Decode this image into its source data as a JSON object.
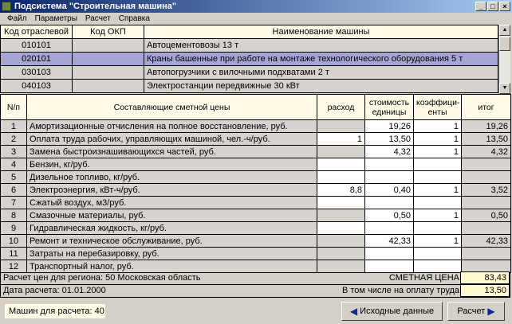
{
  "window": {
    "title": "Подсистема \"Строительная машина\""
  },
  "menu": [
    "Файл",
    "Параметры",
    "Расчет",
    "Справка"
  ],
  "machines": {
    "columns": [
      "Код отраслевой",
      "Код ОКП",
      "Наименование машины"
    ],
    "rows": [
      {
        "code": "010101",
        "okp": "",
        "name": "Автоцементовозы 13 т"
      },
      {
        "code": "020101",
        "okp": "",
        "name": "Краны башенные при работе на монтаже технологического оборудования 5 т",
        "selected": true
      },
      {
        "code": "030103",
        "okp": "",
        "name": "Автопогрузчики с вилочными подхватами 2 т"
      },
      {
        "code": "040103",
        "okp": "",
        "name": "Электростанции передвижные 30 кВт"
      }
    ]
  },
  "costs": {
    "columns": [
      "N/п",
      "Составляющие сметной цены",
      "расход",
      "стоимость единицы",
      "коэффици-енты",
      "итог"
    ],
    "rows": [
      {
        "n": "1",
        "name": "Амортизационные отчисления на полное восстановление, руб.",
        "usage": "",
        "price": "19,26",
        "coef": "1",
        "total": "19,26",
        "usage_editable": false
      },
      {
        "n": "2",
        "name": "Оплата труда рабочих, управляющих машиной, чел.-ч/руб.",
        "usage": "1",
        "price": "13,50",
        "coef": "1",
        "total": "13,50",
        "usage_editable": true
      },
      {
        "n": "3",
        "name": "Замена быстроизнашивающихся частей, руб.",
        "usage": "",
        "price": "4,32",
        "coef": "1",
        "total": "4,32",
        "usage_editable": false
      },
      {
        "n": "4",
        "name": "Бензин, кг/руб.",
        "usage": "",
        "price": "",
        "coef": "",
        "total": "",
        "usage_editable": true
      },
      {
        "n": "5",
        "name": "Дизельное топливо, кг/руб.",
        "usage": "",
        "price": "",
        "coef": "",
        "total": "",
        "usage_editable": true
      },
      {
        "n": "6",
        "name": "Электроэнергия, кВт-ч/руб.",
        "usage": "8,8",
        "price": "0,40",
        "coef": "1",
        "total": "3,52",
        "usage_editable": true
      },
      {
        "n": "7",
        "name": "Сжатый воздух, м3/руб.",
        "usage": "",
        "price": "",
        "coef": "",
        "total": "",
        "usage_editable": true
      },
      {
        "n": "8",
        "name": "Смазочные материалы, руб.",
        "usage": "",
        "price": "0,50",
        "coef": "1",
        "total": "0,50",
        "usage_editable": false
      },
      {
        "n": "9",
        "name": "Гидравлическая жидкость, кг/руб.",
        "usage": "",
        "price": "",
        "coef": "",
        "total": "",
        "usage_editable": true
      },
      {
        "n": "10",
        "name": "Ремонт и техническое обслуживание, руб.",
        "usage": "",
        "price": "42,33",
        "coef": "1",
        "total": "42,33",
        "usage_editable": false
      },
      {
        "n": "11",
        "name": "Затраты на перебазировку, руб.",
        "usage": "",
        "price": "",
        "coef": "",
        "total": "",
        "usage_editable": false
      },
      {
        "n": "12",
        "name": "Транспортный налог, руб.",
        "usage": "",
        "price": "",
        "coef": "",
        "total": "",
        "usage_editable": false
      }
    ]
  },
  "footer": {
    "region": "Расчет цен для региона: 50 Московская область",
    "date": "Дата расчета: 01.01.2000",
    "total_label": "СМЕТНАЯ ЦЕНА",
    "total_value": "83,43",
    "labor_label": "В том числе на оплату труда",
    "labor_value": "13,50"
  },
  "bottom": {
    "count": "Машин для расчета: 40",
    "back_button": "Исходные данные",
    "calc_button": "Расчет"
  }
}
